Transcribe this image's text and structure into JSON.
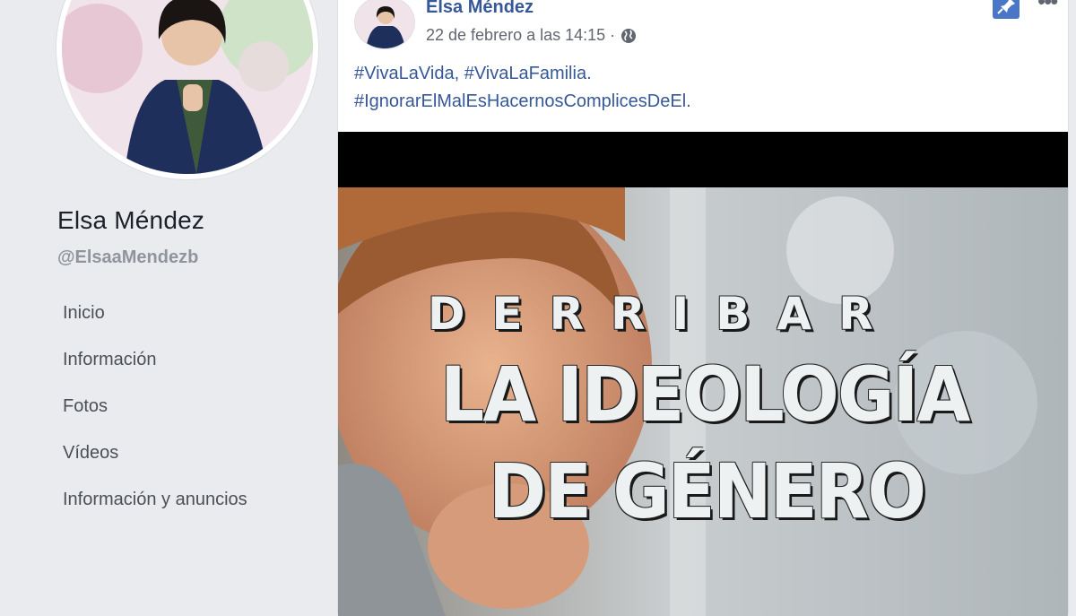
{
  "profile": {
    "name": "Elsa Méndez",
    "handle": "@ElsaaMendezb"
  },
  "side_nav": [
    {
      "label": "Inicio"
    },
    {
      "label": "Información"
    },
    {
      "label": "Fotos"
    },
    {
      "label": "Vídeos"
    },
    {
      "label": "Información y anuncios"
    }
  ],
  "post": {
    "author": "Elsa Méndez",
    "timestamp": "22 de febrero a las 14:15 ·",
    "hashtags_line1": "#VivaLaVida, #VivaLaFamilia.",
    "hashtags_line2": "#IgnorarElMalEsHacernosComplicesDeEl.",
    "more_label": "•••",
    "media_text": {
      "line1": "DERRIBAR",
      "line2": "LA IDEOLOGÍA",
      "line3": "DE GÉNERO"
    }
  },
  "colors": {
    "page_bg": "#e9ebee",
    "link": "#365899",
    "pin": "#4a76c8"
  }
}
